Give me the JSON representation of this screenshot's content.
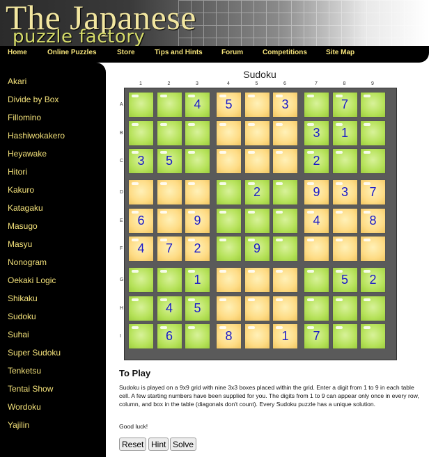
{
  "header": {
    "logo_main": "The Japanese",
    "logo_sub": "puzzle factory"
  },
  "nav": [
    "Home",
    "Online Puzzles",
    "Store",
    "Tips and Hints",
    "Forum",
    "Competitions",
    "Site Map"
  ],
  "sidebar": [
    "Akari",
    "Divide by Box",
    "Fillomino",
    "Hashiwokakero",
    "Heyawake",
    "Hitori",
    "Kakuro",
    "Katagaku",
    "Masugo",
    "Masyu",
    "Nonogram",
    "Oekaki Logic",
    "Shikaku",
    "Sudoku",
    "Suhai",
    "Super Sudoku",
    "Tenketsu",
    "Tentai Show",
    "Wordoku",
    "Yajilin"
  ],
  "puzzle": {
    "title": "Sudoku",
    "col_labels": [
      "1",
      "2",
      "3",
      "4",
      "5",
      "6",
      "7",
      "8",
      "9"
    ],
    "row_labels": [
      "A",
      "B",
      "C",
      "D",
      "E",
      "F",
      "G",
      "H",
      "I"
    ],
    "cells": [
      [
        "",
        "",
        "4",
        "5",
        "",
        "3",
        "",
        "7",
        ""
      ],
      [
        "",
        "",
        "",
        "",
        "",
        "",
        "3",
        "1",
        ""
      ],
      [
        "3",
        "5",
        "",
        "",
        "",
        "",
        "2",
        "",
        ""
      ],
      [
        "",
        "",
        "",
        "",
        "2",
        "",
        "9",
        "3",
        "7"
      ],
      [
        "6",
        "",
        "9",
        "",
        "",
        "",
        "4",
        "",
        "8"
      ],
      [
        "4",
        "7",
        "2",
        "",
        "9",
        "",
        "",
        "",
        ""
      ],
      [
        "",
        "",
        "1",
        "",
        "",
        "",
        "",
        "5",
        "2"
      ],
      [
        "",
        "4",
        "5",
        "",
        "",
        "",
        "",
        "",
        ""
      ],
      [
        "",
        "6",
        "",
        "8",
        "",
        "1",
        "7",
        "",
        ""
      ]
    ],
    "box_colors": [
      "green",
      "yellow",
      "green",
      "yellow",
      "green",
      "yellow",
      "green",
      "yellow",
      "green"
    ]
  },
  "instructions": {
    "heading": "To Play",
    "text": "Sudoku is played on a 9x9 grid with nine 3x3 boxes placed within the grid. Enter a digit from 1 to 9 in each table cell. A few starting numbers have been supplied for you. The digits from 1 to 9 can appear only once in every row, column, and box in the table (diagonals don't count). Every Sudoku puzzle has a unique solution.",
    "good_luck": "Good luck!"
  },
  "buttons": {
    "reset": "Reset",
    "hint": "Hint",
    "solve": "Solve"
  }
}
